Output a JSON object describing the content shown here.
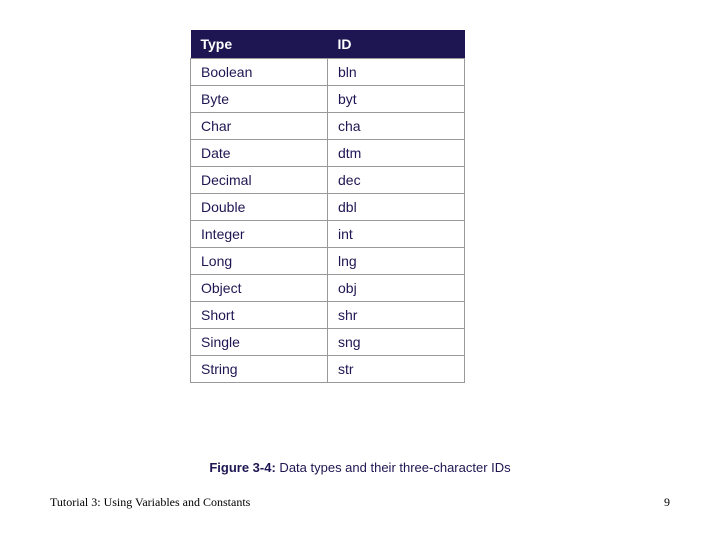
{
  "table": {
    "headers": {
      "type": "Type",
      "id": "ID"
    },
    "rows": [
      {
        "type": "Boolean",
        "id": "bln"
      },
      {
        "type": "Byte",
        "id": "byt"
      },
      {
        "type": "Char",
        "id": "cha"
      },
      {
        "type": "Date",
        "id": "dtm"
      },
      {
        "type": "Decimal",
        "id": "dec"
      },
      {
        "type": "Double",
        "id": "dbl"
      },
      {
        "type": "Integer",
        "id": "int"
      },
      {
        "type": "Long",
        "id": "lng"
      },
      {
        "type": "Object",
        "id": "obj"
      },
      {
        "type": "Short",
        "id": "shr"
      },
      {
        "type": "Single",
        "id": "sng"
      },
      {
        "type": "String",
        "id": "str"
      }
    ]
  },
  "caption": {
    "label": "Figure 3-4:",
    "text": " Data types and their three-character IDs"
  },
  "footer": {
    "left": "Tutorial 3: Using Variables and Constants",
    "right": "9"
  }
}
